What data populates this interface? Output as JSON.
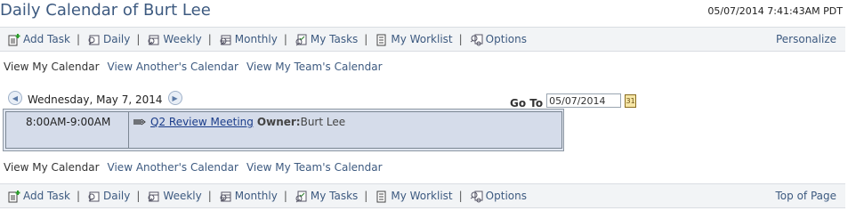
{
  "header": {
    "title": "Daily Calendar of Burt Lee",
    "datetime": "05/07/2014 7:41:43AM PDT"
  },
  "toolbar": {
    "items": [
      {
        "label": "Add Task",
        "icon": "add-task-icon"
      },
      {
        "label": "Daily",
        "icon": "daily-icon"
      },
      {
        "label": "Weekly",
        "icon": "weekly-icon"
      },
      {
        "label": "Monthly",
        "icon": "monthly-icon"
      },
      {
        "label": "My Tasks",
        "icon": "tasks-icon"
      },
      {
        "label": "My Worklist",
        "icon": "worklist-icon"
      },
      {
        "label": "Options",
        "icon": "options-icon"
      }
    ],
    "top_right": "Personalize",
    "bottom_right": "Top of Page"
  },
  "links": [
    "View My Calendar",
    "View Another's Calendar",
    "View My Team's Calendar"
  ],
  "nav": {
    "date": "Wednesday, May 7, 2014"
  },
  "goto": {
    "label": "Go To",
    "value": "05/07/2014"
  },
  "event": {
    "time": "8:00AM-9:00AM",
    "title": "Q2 Review Meeting",
    "owner_label": "Owner:",
    "owner": "Burt Lee"
  }
}
